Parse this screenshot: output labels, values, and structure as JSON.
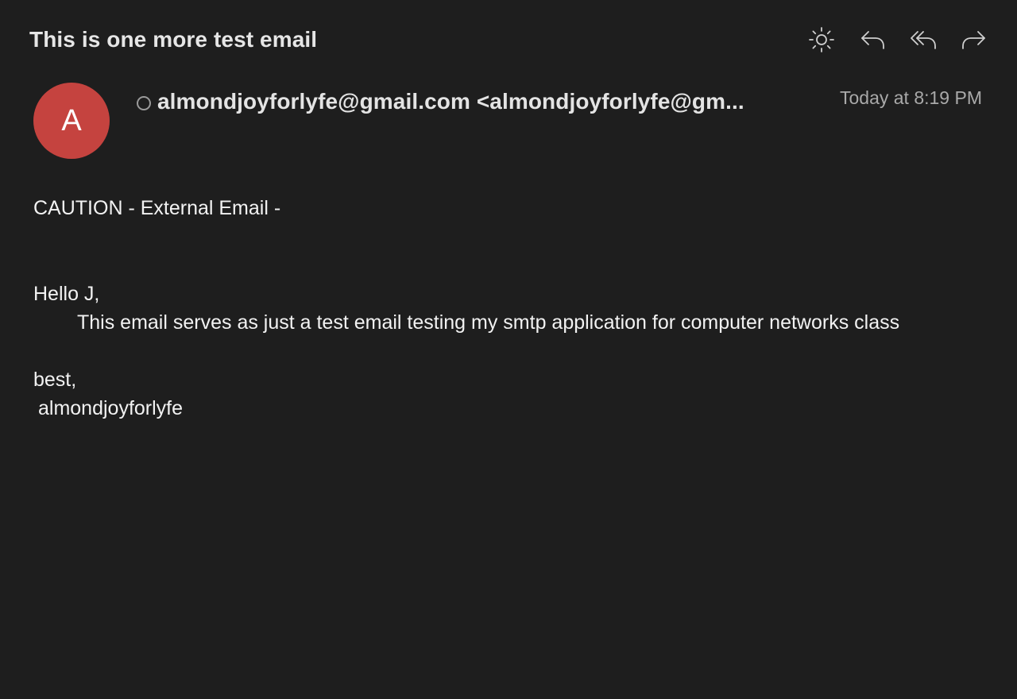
{
  "message": {
    "subject": "This is one more test email",
    "sender": "almondjoyforlyfe@gmail.com <almondjoyforlyfe@gm...",
    "avatar_initial": "A",
    "timestamp": "Today at 8:19 PM"
  },
  "toolbar": {
    "buttons": [
      {
        "name": "appearance",
        "icon": "sun-icon"
      },
      {
        "name": "reply",
        "icon": "reply-icon"
      },
      {
        "name": "reply-all",
        "icon": "reply-all-icon"
      },
      {
        "name": "forward",
        "icon": "forward-icon"
      }
    ]
  },
  "colors": {
    "background": "#1e1e1e",
    "avatar": "#c5433f",
    "timestamp": "#a9a9a9",
    "text": "#f2f2f2"
  },
  "body": {
    "caution": "CAUTION - External Email -",
    "greeting": "Hello J,",
    "paragraph": "This email serves as just a test email testing my smtp application for computer networks class",
    "closing": "best,",
    "signature": "almondjoyforlyfe"
  }
}
